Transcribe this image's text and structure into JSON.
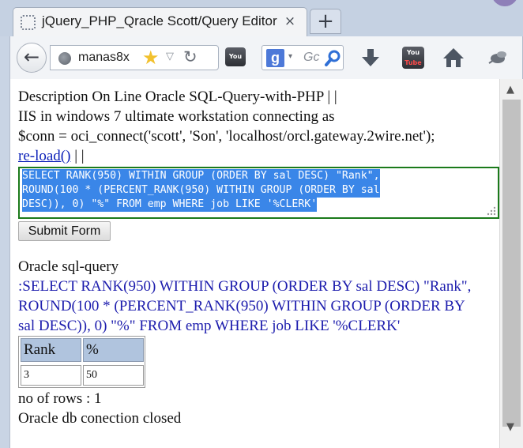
{
  "tab": {
    "title": "jQuery_PHP_Qracle Scott/Query Editor",
    "close": "×",
    "new_tab": "+"
  },
  "toolbar": {
    "back": "←",
    "url": "manas8x",
    "bookmark_star": "★",
    "url_dropdown": "▽",
    "reload": "↻",
    "search_engine": "g",
    "search_dropdown": "▾",
    "search_placeholder": "Gc",
    "youtube_top": "You",
    "youtube_bottom": "Tube"
  },
  "page": {
    "description_line": "Description On Line Oracle SQL-Query-with-PHP | |",
    "iis_line": "IIS in windows 7 ultimate workstation connecting as",
    "conn_line": "$conn = oci_connect('scott', 'Son', 'localhost/orcl.gateway.2wire.net');",
    "reload_link": "re-load()",
    "reload_suffix": "| |",
    "sql_lines": [
      "SELECT RANK(950) WITHIN GROUP (ORDER BY sal DESC) \"Rank\",",
      "ROUND(100 * (PERCENT_RANK(950) WITHIN GROUP (ORDER BY sal",
      "DESC)), 0) \"%\" FROM emp WHERE job LIKE '%CLERK'"
    ],
    "submit_label": "Submit Form",
    "query_heading": "Oracle sql-query",
    "query_lines": [
      ":SELECT RANK(950) WITHIN GROUP (ORDER BY sal DESC) \"Rank\",",
      "ROUND(100 * (PERCENT_RANK(950) WITHIN GROUP (ORDER BY",
      "sal DESC)), 0) \"%\" FROM emp WHERE job LIKE '%CLERK'"
    ],
    "table": {
      "headers": [
        "Rank",
        "%"
      ],
      "rows": [
        [
          "3",
          "50"
        ]
      ]
    },
    "rows_text": "no of rows : 1",
    "closed_text": "Oracle db conection closed"
  },
  "colors": {
    "selection": "#3a86e8",
    "sql_border": "#1b7a1b",
    "table_header": "#b0c4de",
    "link": "#0a1fb8",
    "query_text": "#1c1cad"
  },
  "icons": [
    "page-icon",
    "globe-icon",
    "star-icon",
    "reload-icon",
    "search-icon",
    "download-arrow-icon",
    "youtube-icon",
    "home-icon",
    "bug-icon"
  ]
}
